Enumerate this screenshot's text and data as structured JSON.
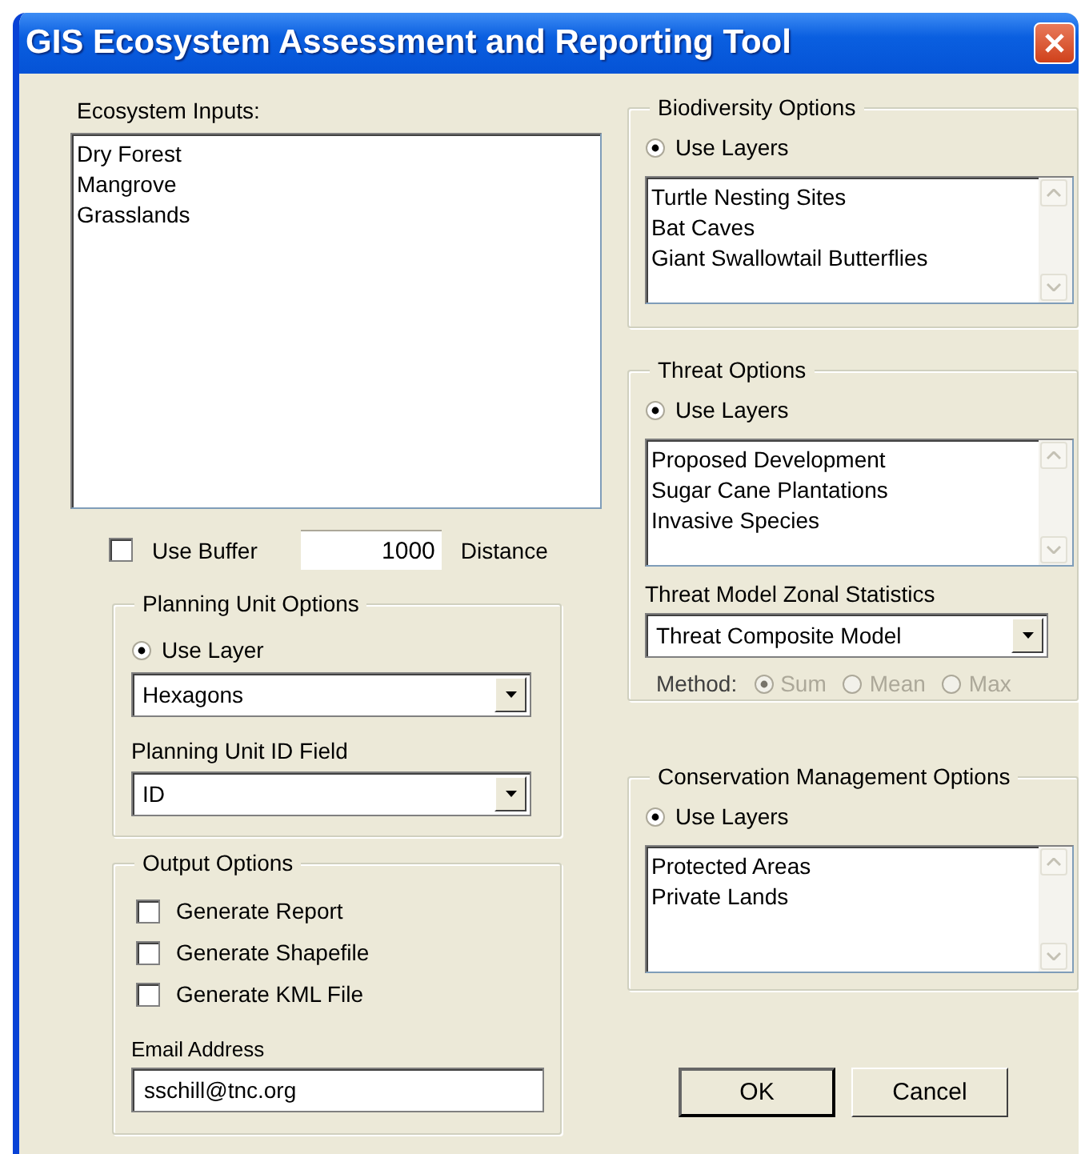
{
  "window": {
    "title": "GIS Ecosystem Assessment and Reporting Tool"
  },
  "ecosystem_inputs": {
    "label": "Ecosystem Inputs:",
    "items": [
      {
        "label": "Dry Forest"
      },
      {
        "label": "Mangrove"
      },
      {
        "label": "Grasslands"
      }
    ]
  },
  "buffer": {
    "label": "Use Buffer",
    "checked": false,
    "value": "1000",
    "unit": "Distance"
  },
  "planning_unit": {
    "title": "Planning Unit Options",
    "radio": {
      "label": "Use Layer",
      "selected": true
    },
    "layer": {
      "value": "Hexagons"
    },
    "id_field": {
      "label": "Planning Unit ID Field",
      "value": "ID"
    }
  },
  "output": {
    "title": "Output Options",
    "options": [
      {
        "label": "Generate Report",
        "checked": false
      },
      {
        "label": "Generate Shapefile",
        "checked": false
      },
      {
        "label": "Generate KML File",
        "checked": false
      }
    ],
    "email": {
      "label": "Email Address",
      "value": "sschill@tnc.org"
    }
  },
  "biodiversity": {
    "title": "Biodiversity Options",
    "radio": {
      "label": "Use Layers",
      "selected": true
    },
    "items": [
      {
        "label": "Turtle Nesting Sites"
      },
      {
        "label": "Bat Caves"
      },
      {
        "label": "Giant Swallowtail Butterflies"
      }
    ]
  },
  "threat": {
    "title": "Threat Options",
    "radio": {
      "label": "Use Layers",
      "selected": true
    },
    "items": [
      {
        "label": "Proposed Development"
      },
      {
        "label": "Sugar Cane Plantations"
      },
      {
        "label": "Invasive Species"
      }
    ],
    "zonal": {
      "label": "Threat Model Zonal Statistics",
      "value": "Threat Composite Model"
    },
    "method": {
      "label": "Method:",
      "disabled": true,
      "options": [
        {
          "label": "Sum",
          "selected": true
        },
        {
          "label": "Mean",
          "selected": false
        },
        {
          "label": "Max",
          "selected": false
        }
      ]
    }
  },
  "conservation": {
    "title": "Conservation Management Options",
    "radio": {
      "label": "Use Layers",
      "selected": true
    },
    "items": [
      {
        "label": "Protected Areas"
      },
      {
        "label": "Private Lands"
      }
    ]
  },
  "buttons": [
    {
      "label": "OK",
      "default": true
    },
    {
      "label": "Cancel",
      "default": false
    }
  ]
}
